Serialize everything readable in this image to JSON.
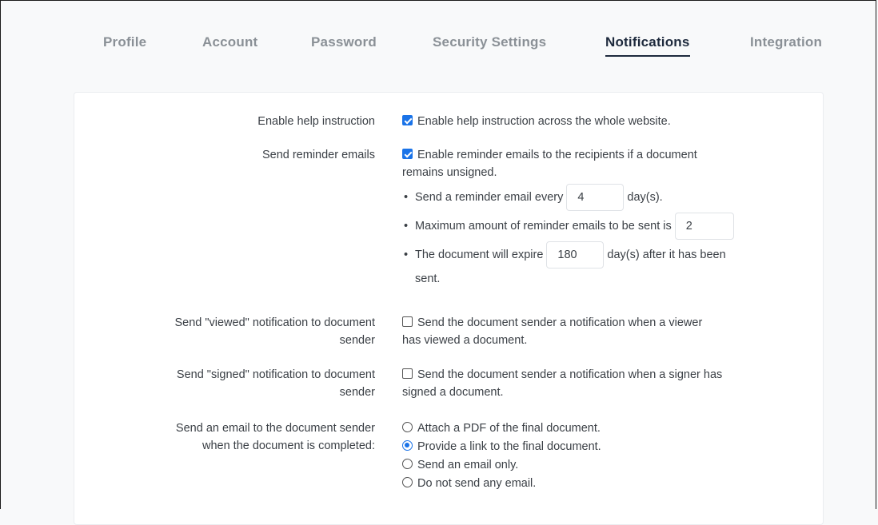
{
  "tabs": [
    {
      "label": "Profile"
    },
    {
      "label": "Account"
    },
    {
      "label": "Password"
    },
    {
      "label": "Security Settings"
    },
    {
      "label": "Notifications",
      "active": true
    },
    {
      "label": "Integration"
    }
  ],
  "settings": {
    "help": {
      "label": "Enable help instruction",
      "checkbox_text": "Enable help instruction across the whole website.",
      "checked": true
    },
    "reminders": {
      "label": "Send reminder emails",
      "checkbox_text_1": "Enable reminder emails to the recipients if a document",
      "checkbox_text_2": "remains unsigned.",
      "checked": true,
      "every_prefix": "Send a reminder email every",
      "every_value": "4",
      "every_suffix": "day(s).",
      "max_prefix": "Maximum amount of reminder emails to be sent is",
      "max_value": "2",
      "expire_prefix": "The document will expire",
      "expire_value": "180",
      "expire_suffix_1": "day(s) after it has been",
      "expire_suffix_2": "sent."
    },
    "viewed": {
      "label_1": "Send \"viewed\" notification to document",
      "label_2": "sender",
      "text_1": "Send the document sender a notification when a viewer",
      "text_2": "has viewed a document.",
      "checked": false
    },
    "signed": {
      "label_1": "Send \"signed\" notification to document",
      "label_2": "sender",
      "text_1": "Send the document sender a notification when a signer has",
      "text_2": "signed a document.",
      "checked": false
    },
    "completed": {
      "label_1": "Send an email to the document sender",
      "label_2": "when the document is completed:",
      "options": [
        {
          "label": "Attach a PDF of the final document.",
          "selected": false
        },
        {
          "label": "Provide a link to the final document.",
          "selected": true
        },
        {
          "label": "Send an email only.",
          "selected": false
        },
        {
          "label": "Do not send any email.",
          "selected": false
        }
      ]
    }
  },
  "colors": {
    "accent": "#1a73e8",
    "active_tab": "#1e2a3d",
    "inactive_tab": "#8a9096"
  }
}
